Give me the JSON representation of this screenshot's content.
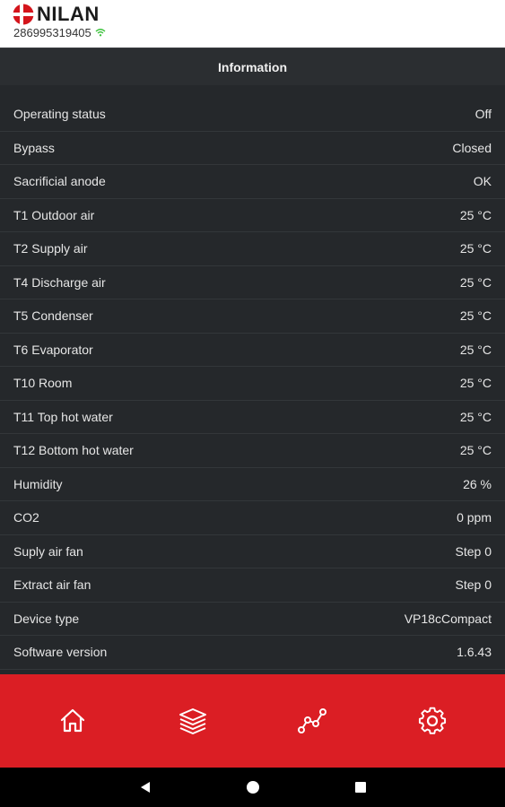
{
  "header": {
    "brand": "NILAN",
    "serial": "286995319405",
    "wifi_icon": "wifi-icon",
    "logo_icon": "danish-flag-icon"
  },
  "titlebar": {
    "title": "Information"
  },
  "info": {
    "rows": [
      {
        "label": "Operating status",
        "value": "Off"
      },
      {
        "label": "Bypass",
        "value": "Closed"
      },
      {
        "label": "Sacrificial anode",
        "value": "OK"
      },
      {
        "label": "T1 Outdoor air",
        "value": "25 °C"
      },
      {
        "label": "T2 Supply air",
        "value": "25 °C"
      },
      {
        "label": "T4 Discharge air",
        "value": "25 °C"
      },
      {
        "label": "T5 Condenser",
        "value": "25 °C"
      },
      {
        "label": "T6 Evaporator",
        "value": "25 °C"
      },
      {
        "label": "T10 Room",
        "value": "25 °C"
      },
      {
        "label": "T11 Top hot water",
        "value": "25 °C"
      },
      {
        "label": "T12 Bottom hot water",
        "value": "25 °C"
      },
      {
        "label": "Humidity",
        "value": "26 %"
      },
      {
        "label": "CO2",
        "value": "0 ppm"
      },
      {
        "label": "Suply air fan",
        "value": "Step 0"
      },
      {
        "label": "Extract air fan",
        "value": "Step 0"
      },
      {
        "label": "Device type",
        "value": "VP18cCompact"
      },
      {
        "label": "Software version",
        "value": "1.6.43"
      }
    ]
  },
  "bottom_nav": {
    "items": [
      "home-icon",
      "layers-icon",
      "graph-icon",
      "gear-icon"
    ]
  },
  "system_nav": {
    "items": [
      "back-icon",
      "home-circle-icon",
      "recents-icon"
    ]
  },
  "colors": {
    "accent": "#db1e24",
    "background": "#25282b",
    "header_bg": "#ffffff"
  }
}
